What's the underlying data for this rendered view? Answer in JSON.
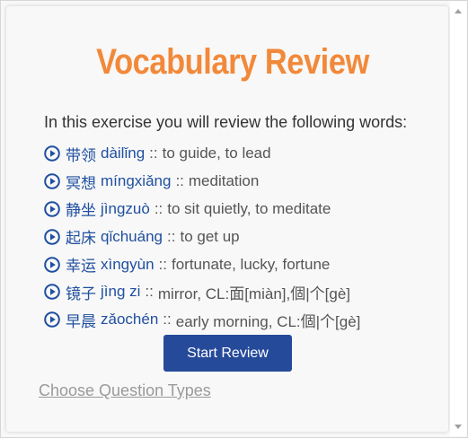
{
  "title": "Vocabulary Review",
  "intro": "In this exercise you will review the following words:",
  "words": [
    {
      "hanzi": "带领",
      "pinyin": "dàilǐng",
      "sep": "::",
      "meaning": "to guide, to lead"
    },
    {
      "hanzi": "冥想",
      "pinyin": "míngxiǎng",
      "sep": "::",
      "meaning": "meditation"
    },
    {
      "hanzi": "静坐",
      "pinyin": "jìngzuò",
      "sep": "::",
      "meaning": "to sit quietly, to meditate"
    },
    {
      "hanzi": "起床",
      "pinyin": "qǐchuáng",
      "sep": "::",
      "meaning": "to get up"
    },
    {
      "hanzi": "幸运",
      "pinyin": "xìngyùn",
      "sep": "::",
      "meaning": "fortunate, lucky, fortune"
    },
    {
      "hanzi": "镜子",
      "pinyin": "jìng zi",
      "sep": "::",
      "meaning": "mirror, CL:面[miàn],個|个[gè]"
    },
    {
      "hanzi": "早晨",
      "pinyin": "zǎochén",
      "sep": "::",
      "meaning": "early morning, CL:個|个[gè]"
    }
  ],
  "start_button": "Start Review",
  "question_types_link": "Choose Question Types",
  "icons": {
    "play": "play-circle-icon"
  },
  "colors": {
    "title": "#f2893a",
    "link_blue": "#1f4f9f",
    "button": "#264a9a",
    "muted_link": "#9a9a9a"
  }
}
